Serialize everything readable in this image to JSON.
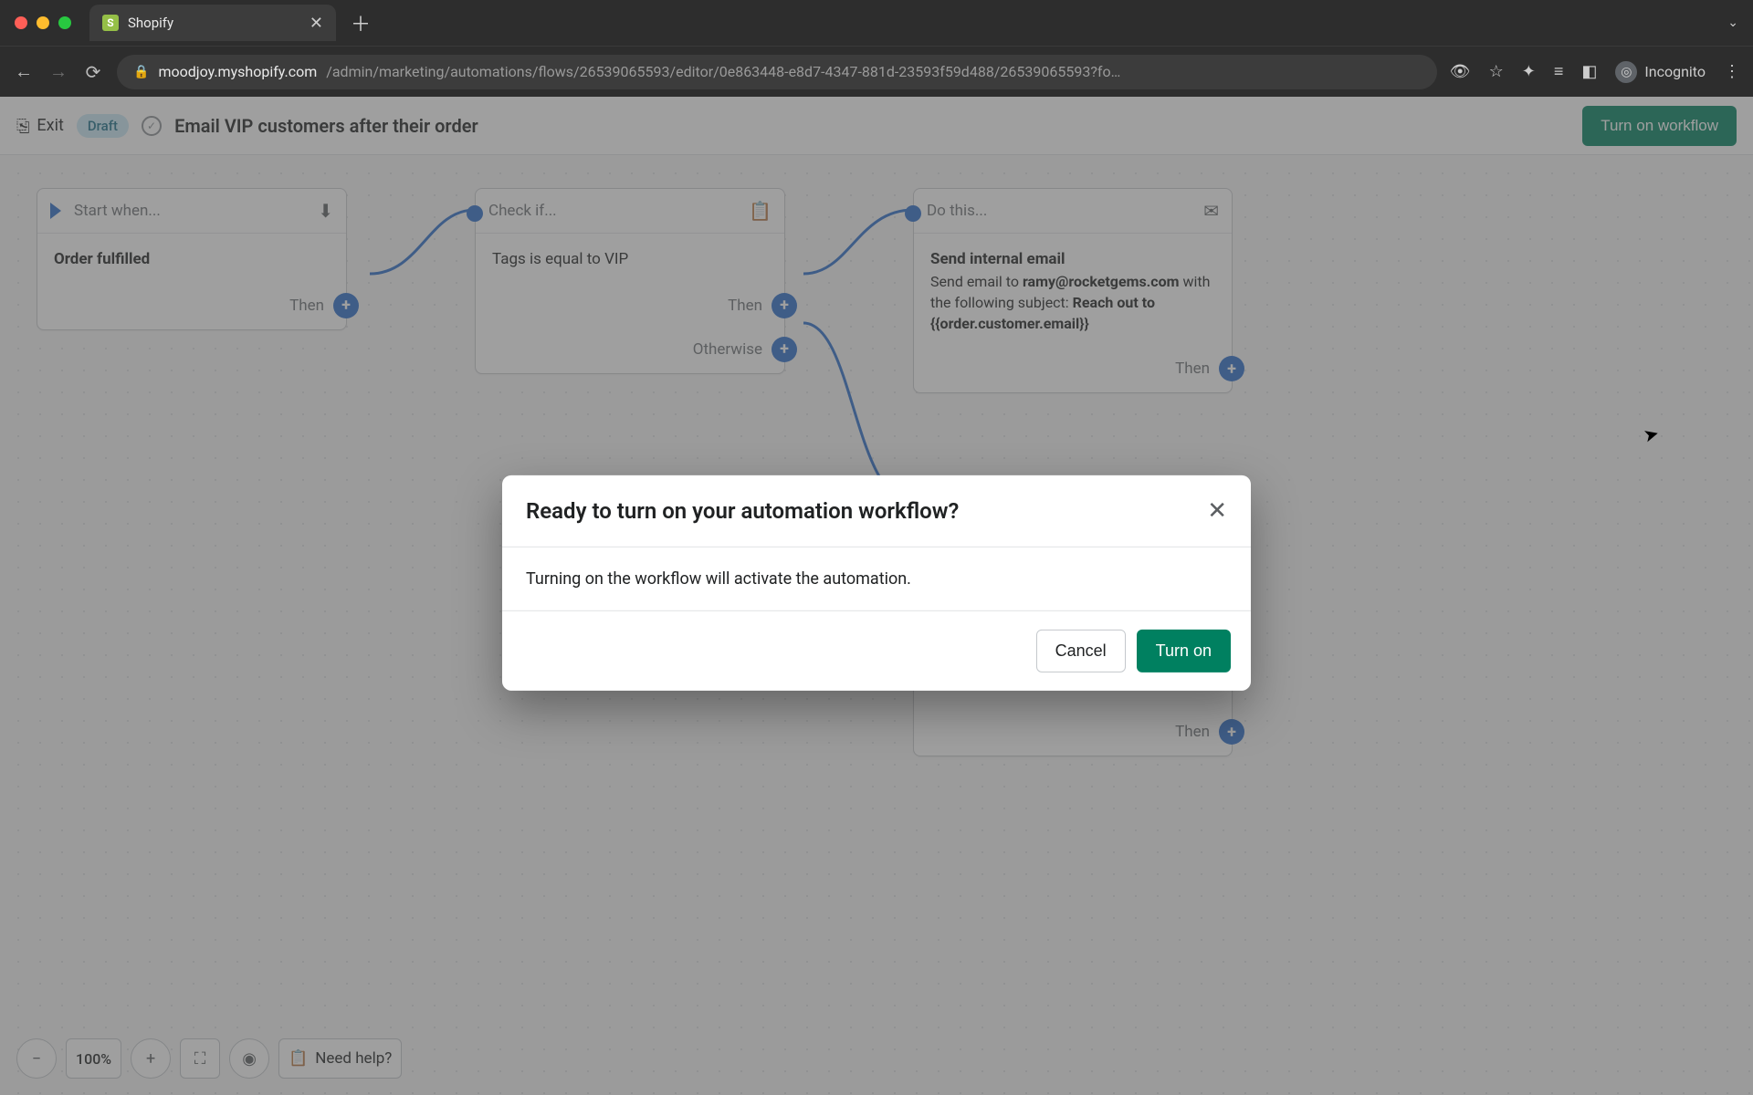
{
  "browser": {
    "tab_title": "Shopify",
    "url_domain": "moodjoy.myshopify.com",
    "url_rest": "/admin/marketing/automations/flows/26539065593/editor/0e863448-e8d7-4347-881d-23593f59d488/26539065593?fo…",
    "incognito_label": "Incognito"
  },
  "appbar": {
    "exit": "Exit",
    "status_badge": "Draft",
    "workflow_title": "Email VIP customers after their order",
    "turn_on": "Turn on workflow"
  },
  "nodes": {
    "start": {
      "head": "Start when...",
      "title": "Order fulfilled",
      "port": "Then"
    },
    "check": {
      "head": "Check if...",
      "condition": "Tags is equal to VIP",
      "port_then": "Then",
      "port_else": "Otherwise"
    },
    "action": {
      "head": "Do this...",
      "title": "Send internal email",
      "line1_pre": "Send email to ",
      "email": "ramy@rocketgems.com",
      "line1_post": " with the following subject: ",
      "subject": "Reach out to {{order.customer.email}}",
      "port": "Then"
    },
    "action2_port": "Then"
  },
  "bottom": {
    "zoom": "100%",
    "help": "Need help?"
  },
  "modal": {
    "title": "Ready to turn on your automation workflow?",
    "body": "Turning on the workflow will activate the automation.",
    "cancel": "Cancel",
    "confirm": "Turn on"
  }
}
